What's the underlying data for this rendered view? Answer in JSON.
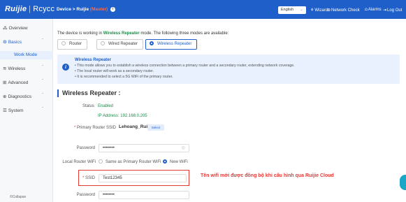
{
  "header": {
    "logo_brand": "Ruijie",
    "logo_product": "Rcycc",
    "breadcrumb_device": "Device",
    "breadcrumb_sep": ">",
    "breadcrumb_current": "Ruijie",
    "breadcrumb_model": "(Master)",
    "language": "English",
    "nav": [
      {
        "icon": "⚘",
        "label": "Wizard"
      },
      {
        "icon": "⊕",
        "label": "Network Check"
      },
      {
        "icon": "⩍",
        "label": "Alarms"
      },
      {
        "icon": "⇥",
        "label": "Log Out"
      }
    ]
  },
  "sidebar": {
    "items": [
      {
        "icon": "⁂",
        "label": "Overview"
      },
      {
        "icon": "⚙",
        "label": "Basics",
        "arrow": "ˇ"
      },
      {
        "label": "Work Mode"
      },
      {
        "icon": "≋",
        "label": "Wireless",
        "arrow": "ˇ"
      },
      {
        "icon": "⊞",
        "label": "Advanced",
        "arrow": "ˇ"
      },
      {
        "icon": "⊕",
        "label": "Diagnostics",
        "arrow": "ˇ"
      },
      {
        "icon": "☰",
        "label": "System",
        "arrow": "ˇ"
      }
    ],
    "copyright": "©Collapse"
  },
  "main": {
    "mode_text_prefix": "The device is working in",
    "mode_text_mode": "Wireless Repeater",
    "mode_text_suffix": "mode. The following three modes are available:",
    "modes": [
      "Router",
      "Wired Repeater",
      "Wireless Repeater"
    ],
    "info": {
      "title": "Wireless Repeater",
      "bullets": [
        "• This mode allows you to establish a wireless connection between a primary router and a secondary router, extending network coverage.",
        "• The local router will work as a secondary router.",
        "• It is recommended to select a 5G WiFi of the primary router."
      ]
    },
    "section_title": "Wireless Repeater :",
    "status_label": "Status",
    "status_value": "Enabled",
    "ip_text": "IP Address: 192.168.0.205",
    "primary_ssid_req": "*",
    "primary_ssid_label": "Primary Router SSID",
    "primary_ssid_value": "Lehoang_Ruijie",
    "select_label": "Select",
    "password_label": "Password",
    "password_value": "••••••••",
    "local_wifi_label": "Local Router WiFi",
    "local_wifi_options": [
      "Same as Primary Router WiFi",
      "New WiFi"
    ],
    "ssid_req": "*",
    "ssid_label": "SSID",
    "ssid_value": "Test12345",
    "password2_label": "Password",
    "password2_value": "••••••••"
  },
  "annotation": "Tên wifi mới được đồng bộ khi cấu hình qua Ruijie Cloud",
  "colors": {
    "brand": "#1f5fc9",
    "success": "#1c8a4a",
    "annotation": "#e53935"
  }
}
